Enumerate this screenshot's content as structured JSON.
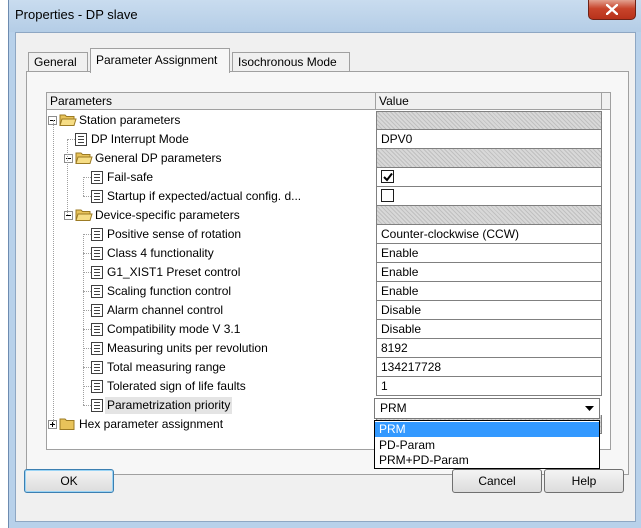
{
  "window": {
    "title": "Properties - DP slave",
    "close_glyph": "X"
  },
  "tabs": [
    {
      "label": "General",
      "active": false
    },
    {
      "label": "Parameter Assignment",
      "active": true
    },
    {
      "label": "Isochronous Mode",
      "active": false
    }
  ],
  "grid": {
    "columns": [
      "Parameters",
      "Value"
    ],
    "rows": [
      {
        "label": "Station parameters",
        "type": "folder",
        "value": ""
      },
      {
        "label": "DP Interrupt Mode",
        "type": "param",
        "value": "DPV0"
      },
      {
        "label": "General DP parameters",
        "type": "folder",
        "value": ""
      },
      {
        "label": "Fail-safe",
        "type": "param",
        "value": "",
        "checkbox": true,
        "checked": true
      },
      {
        "label": "Startup if expected/actual config. d...",
        "type": "param",
        "value": "",
        "checkbox": true,
        "checked": false
      },
      {
        "label": "Device-specific parameters",
        "type": "folder",
        "value": ""
      },
      {
        "label": "Positive sense of rotation",
        "type": "param",
        "value": "Counter-clockwise (CCW)"
      },
      {
        "label": "Class 4 functionality",
        "type": "param",
        "value": "Enable"
      },
      {
        "label": "G1_XIST1 Preset control",
        "type": "param",
        "value": "Enable"
      },
      {
        "label": "Scaling function control",
        "type": "param",
        "value": "Enable"
      },
      {
        "label": "Alarm channel control",
        "type": "param",
        "value": "Disable"
      },
      {
        "label": "Compatibility mode V 3.1",
        "type": "param",
        "value": "Disable"
      },
      {
        "label": "Measuring units per revolution",
        "type": "param",
        "value": "8192"
      },
      {
        "label": "Total measuring range",
        "type": "param",
        "value": "134217728"
      },
      {
        "label": "Tolerated sign of life faults",
        "type": "param",
        "value": "1"
      },
      {
        "label": "Parametrization priority",
        "type": "param",
        "value": "PRM",
        "selected": true
      },
      {
        "label": "Hex parameter assignment",
        "type": "folder",
        "value": ""
      }
    ]
  },
  "combo": {
    "value": "PRM",
    "options": [
      "PRM",
      "PD-Param",
      "PRM+PD-Param"
    ],
    "highlighted": "PRM"
  },
  "buttons": {
    "ok": "OK",
    "cancel": "Cancel",
    "help": "Help"
  }
}
